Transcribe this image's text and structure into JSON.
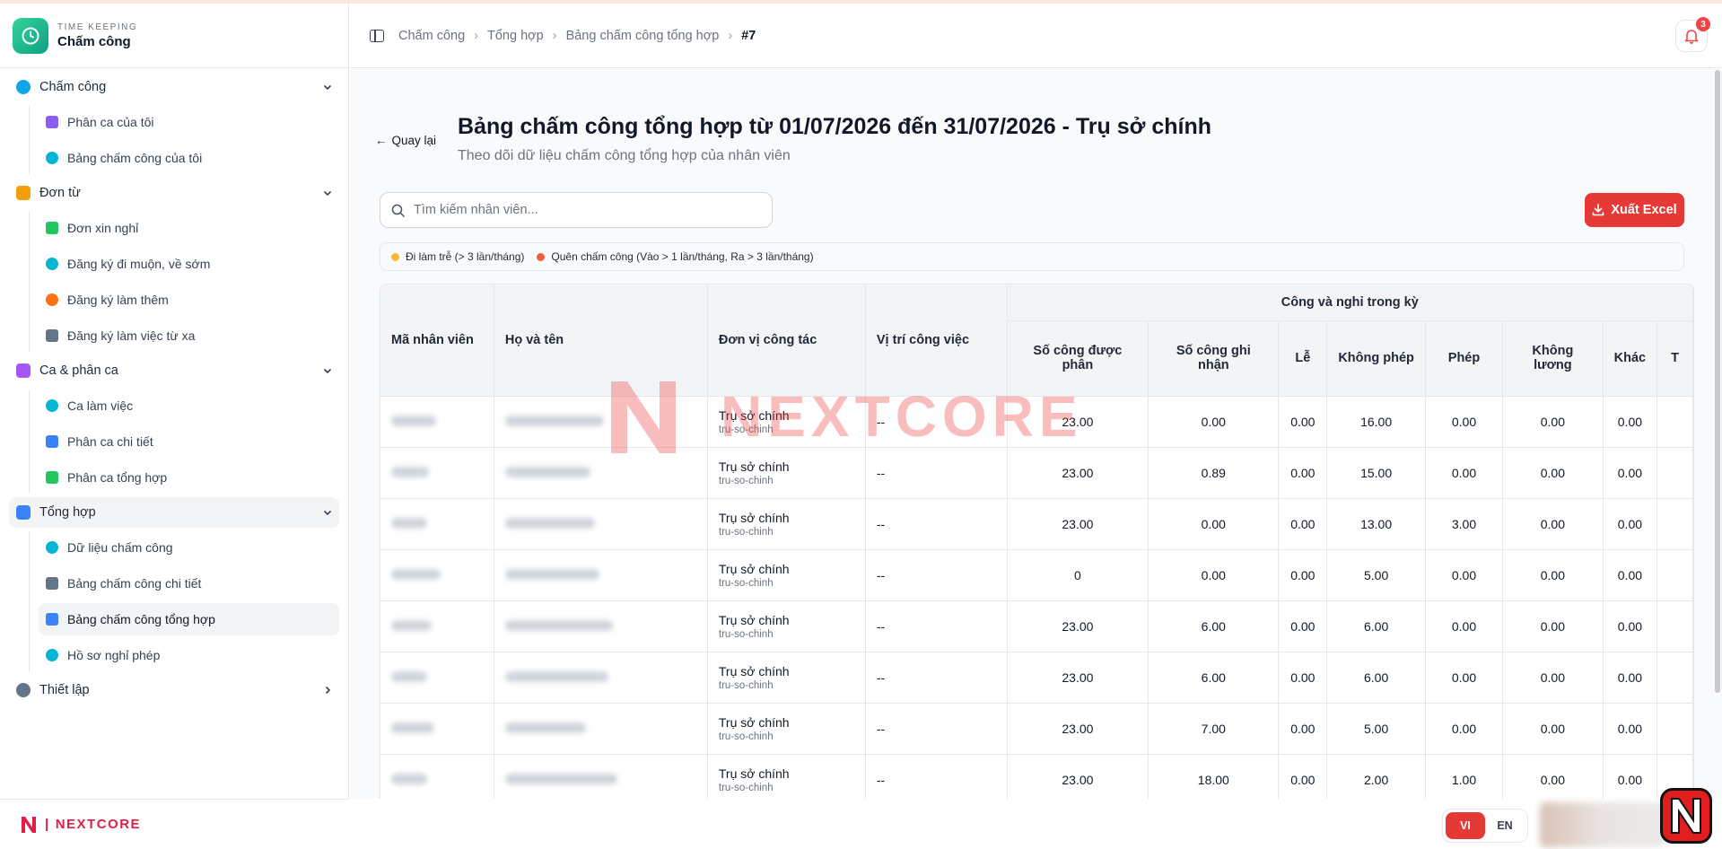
{
  "app": {
    "brand_sub": "TIME KEEPING",
    "brand_title": "Chấm công",
    "footer_logo": "NEXTCORE"
  },
  "sidebar": {
    "groups": [
      {
        "label": "Chấm công",
        "items": [
          "Phân ca của tôi",
          "Bảng chấm công của tôi"
        ]
      },
      {
        "label": "Đơn từ",
        "items": [
          "Đơn xin nghỉ",
          "Đăng ký đi muộn, về sớm",
          "Đăng ký làm thêm",
          "Đăng ký làm việc từ xa"
        ]
      },
      {
        "label": "Ca & phân ca",
        "items": [
          "Ca làm việc",
          "Phân ca chi tiết",
          "Phân ca tổng hợp"
        ]
      },
      {
        "label": "Tổng hợp",
        "items": [
          "Dữ liệu chấm công",
          "Bảng chấm công chi tiết",
          "Bảng chấm công tổng hợp",
          "Hồ sơ nghỉ phép"
        ]
      },
      {
        "label": "Thiết lập",
        "items": []
      }
    ]
  },
  "breadcrumb": [
    "Chấm công",
    "Tổng hợp",
    "Bảng chấm công tổng hợp",
    "#7"
  ],
  "notifications": {
    "count": "3"
  },
  "page": {
    "back_label": "Quay lại",
    "title": "Bảng chấm công tổng hợp từ 01/07/2026 đến 31/07/2026 - Trụ sở chính",
    "subtitle": "Theo dõi dữ liệu chấm công tổng hợp của nhân viên",
    "search_placeholder": "Tìm kiếm nhân viên...",
    "export_label": "Xuất Excel"
  },
  "legend": [
    {
      "label": "Đi làm trễ (> 3 lần/tháng)",
      "color": "#f5b935"
    },
    {
      "label": "Quên chấm công (Vào > 1 lần/tháng, Ra > 3 lần/tháng)",
      "color": "#f0603a"
    }
  ],
  "table": {
    "group_header": "Công và nghỉ trong kỳ",
    "headers": {
      "employee_id": "Mã nhân viên",
      "name": "Họ và tên",
      "unit": "Đơn vị công tác",
      "position": "Vị trí công việc"
    },
    "sub_headers": [
      "Số công được phân",
      "Số công ghi nhận",
      "Lễ",
      "Không phép",
      "Phép",
      "Không lương",
      "Khác",
      "T"
    ],
    "rows": [
      {
        "unit": "Trụ sở chính",
        "unit_code": "tru-so-chinh",
        "position": "--",
        "vals": [
          "23.00",
          "0.00",
          "0.00",
          "16.00",
          "0.00",
          "0.00",
          "0.00"
        ]
      },
      {
        "unit": "Trụ sở chính",
        "unit_code": "tru-so-chinh",
        "position": "--",
        "vals": [
          "23.00",
          "0.89",
          "0.00",
          "15.00",
          "0.00",
          "0.00",
          "0.00"
        ]
      },
      {
        "unit": "Trụ sở chính",
        "unit_code": "tru-so-chinh",
        "position": "--",
        "vals": [
          "23.00",
          "0.00",
          "0.00",
          "13.00",
          "3.00",
          "0.00",
          "0.00"
        ]
      },
      {
        "unit": "Trụ sở chính",
        "unit_code": "tru-so-chinh",
        "position": "--",
        "vals": [
          "0",
          "0.00",
          "0.00",
          "5.00",
          "0.00",
          "0.00",
          "0.00"
        ]
      },
      {
        "unit": "Trụ sở chính",
        "unit_code": "tru-so-chinh",
        "position": "--",
        "vals": [
          "23.00",
          "6.00",
          "0.00",
          "6.00",
          "0.00",
          "0.00",
          "0.00"
        ]
      },
      {
        "unit": "Trụ sở chính",
        "unit_code": "tru-so-chinh",
        "position": "--",
        "vals": [
          "23.00",
          "6.00",
          "0.00",
          "6.00",
          "0.00",
          "0.00",
          "0.00"
        ]
      },
      {
        "unit": "Trụ sở chính",
        "unit_code": "tru-so-chinh",
        "position": "--",
        "vals": [
          "23.00",
          "7.00",
          "0.00",
          "5.00",
          "0.00",
          "0.00",
          "0.00"
        ]
      },
      {
        "unit": "Trụ sở chính",
        "unit_code": "tru-so-chinh",
        "position": "--",
        "vals": [
          "23.00",
          "18.00",
          "0.00",
          "2.00",
          "1.00",
          "0.00",
          "0.00"
        ]
      }
    ]
  },
  "watermark": "NEXTCORE",
  "languages": [
    "VI",
    "EN"
  ]
}
